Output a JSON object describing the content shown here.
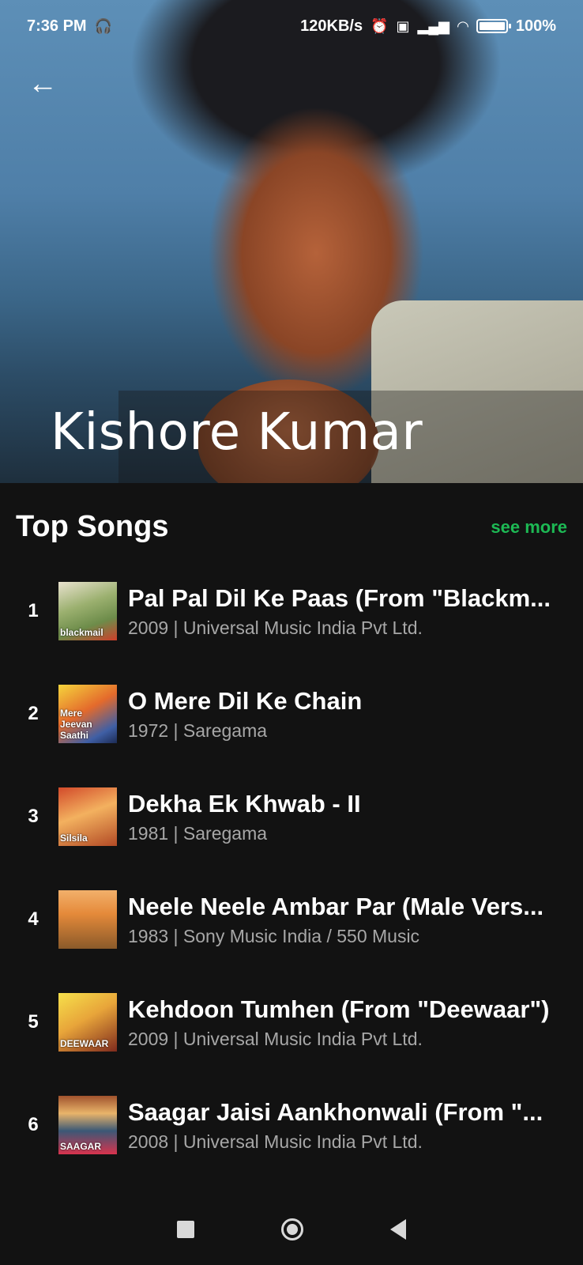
{
  "status_bar": {
    "time": "7:36 PM",
    "net_speed": "120KB/s",
    "battery": "100%"
  },
  "artist": {
    "name": "Kishore Kumar"
  },
  "top_songs": {
    "title": "Top Songs",
    "see_more": "see more",
    "songs": [
      {
        "rank": "1",
        "title": "Pal Pal Dil Ke Paas (From \"Blackm...",
        "subtitle": "2009 | Universal Music India Pvt Ltd.",
        "art_text": "blackmail"
      },
      {
        "rank": "2",
        "title": "O Mere Dil Ke Chain",
        "subtitle": "1972 | Saregama",
        "art_text": "Mere Jeevan Saathi"
      },
      {
        "rank": "3",
        "title": "Dekha Ek Khwab - II",
        "subtitle": "1981 | Saregama",
        "art_text": "Silsila"
      },
      {
        "rank": "4",
        "title": "Neele Neele Ambar Par (Male Vers...",
        "subtitle": "1983 | Sony Music India / 550 Music",
        "art_text": ""
      },
      {
        "rank": "5",
        "title": "Kehdoon Tumhen (From \"Deewaar\")",
        "subtitle": "2009 | Universal Music India Pvt Ltd.",
        "art_text": "DEEWAAR"
      },
      {
        "rank": "6",
        "title": "Saagar Jaisi Aankhonwali (From \"...",
        "subtitle": "2008 | Universal Music India Pvt Ltd.",
        "art_text": "SAAGAR"
      }
    ]
  },
  "colors": {
    "accent": "#1db954",
    "background": "#121212"
  }
}
